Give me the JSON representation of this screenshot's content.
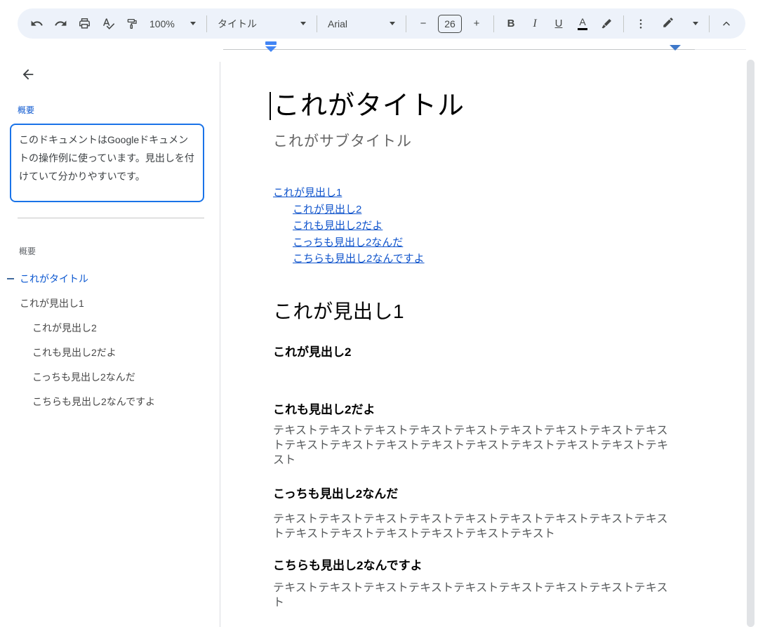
{
  "toolbar": {
    "zoom_value": "100%",
    "style_value": "タイトル",
    "font_value": "Arial",
    "font_size_value": "26",
    "minus_label": "−",
    "plus_label": "+",
    "bold_label": "B",
    "italic_label": "I",
    "underline_label": "U",
    "text_color_label": "A"
  },
  "sidebar": {
    "summary_label": "概要",
    "summary_text": "このドキュメントはGoogleドキュメントの操作例に使っています。見出しを付けていて分かりやすいです。",
    "outline_header": "概要",
    "outline": [
      {
        "label": "これがタイトル",
        "level": 0,
        "active": true
      },
      {
        "label": "これが見出し1",
        "level": 1,
        "active": false
      },
      {
        "label": "これが見出し2",
        "level": 2,
        "active": false
      },
      {
        "label": "これも見出し2だよ",
        "level": 2,
        "active": false
      },
      {
        "label": "こっちも見出し2なんだ",
        "level": 2,
        "active": false
      },
      {
        "label": "こちらも見出し2なんですよ",
        "level": 2,
        "active": false
      }
    ]
  },
  "document": {
    "title": "これがタイトル",
    "subtitle": "これがサブタイトル",
    "toc": [
      {
        "label": "これが見出し1",
        "level": 1
      },
      {
        "label": "これが見出し2",
        "level": 2
      },
      {
        "label": "これも見出し2だよ",
        "level": 2
      },
      {
        "label": "こっちも見出し2なんだ",
        "level": 2
      },
      {
        "label": "こちらも見出し2なんですよ",
        "level": 2
      }
    ],
    "heading1": "これが見出し1",
    "sections": [
      {
        "heading": "これが見出し2",
        "body": ""
      },
      {
        "heading": "これも見出し2だよ",
        "body": "テキストテキストテキストテキストテキストテキストテキストテキストテキストテキストテキストテキストテキストテキストテキストテキストテキストテキスト"
      },
      {
        "heading": "こっちも見出し2なんだ",
        "body": "テキストテキストテキストテキストテキストテキストテキストテキストテキストテキストテキストテキストテキストテキストテキスト"
      },
      {
        "heading": "こちらも見出し2なんですよ",
        "body": "テキストテキストテキストテキストテキストテキストテキストテキストテキスト"
      }
    ]
  },
  "colors": {
    "accent_blue": "#0b57d0",
    "link_blue": "#1155cc",
    "marker_blue": "#4285f4",
    "toolbar_bg": "#edf2fa",
    "icon_gray": "#444746"
  }
}
